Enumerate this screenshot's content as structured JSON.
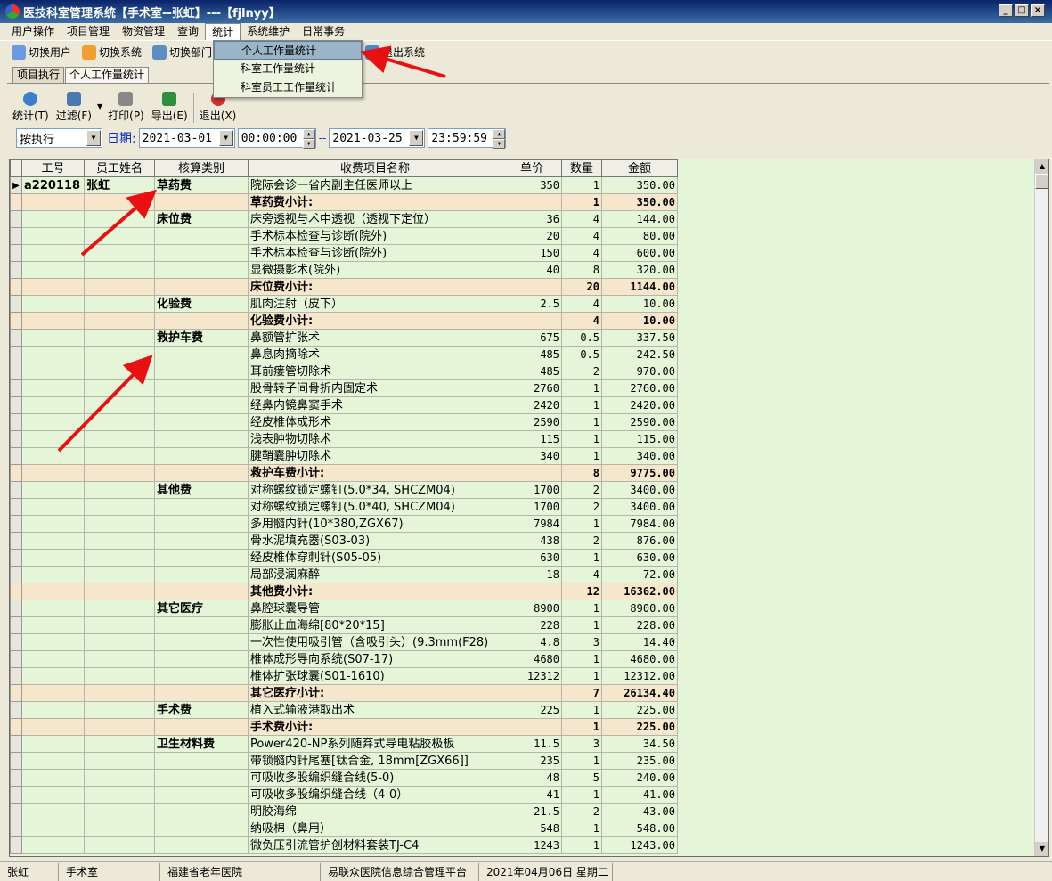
{
  "window": {
    "title": "医技科室管理系统【手术室--张虹】---【fjlnyy】"
  },
  "menubar": [
    "用户操作",
    "项目管理",
    "物资管理",
    "查询",
    "统计",
    "系统维护",
    "日常事务"
  ],
  "toolbar": [
    {
      "label": "切换用户",
      "icon": "switch-user-icon"
    },
    {
      "label": "切换系统",
      "icon": "switch-system-icon"
    },
    {
      "label": "切换部门",
      "icon": "switch-dept-icon"
    },
    {
      "label": "退出系统",
      "icon": "exit-system-icon"
    }
  ],
  "stats_menu": [
    "个人工作量统计",
    "科室工作量统计",
    "科室员工工作量统计"
  ],
  "tabs": [
    "项目执行",
    "个人工作量统计"
  ],
  "actions": [
    {
      "label": "统计(T)",
      "icon": "stats-icon"
    },
    {
      "label": "过滤(F)",
      "icon": "filter-icon"
    },
    {
      "label": "打印(P)",
      "icon": "print-icon"
    },
    {
      "label": "导出(E)",
      "icon": "export-icon"
    },
    {
      "label": "退出(X)",
      "icon": "exit-icon"
    }
  ],
  "filter": {
    "mode": "按执行",
    "date_label": "日期:",
    "start_date": "2021-03-01",
    "start_time": "00:00:00",
    "separator": "--",
    "end_date": "2021-03-25",
    "end_time": "23:59:59"
  },
  "columns": [
    "工号",
    "员工姓名",
    "核算类别",
    "收费项目名称",
    "单价",
    "数量",
    "金额"
  ],
  "rows": [
    [
      "a220118",
      "张虹",
      "草药费",
      "院际会诊一省内副主任医师以上",
      "350",
      "1",
      "350.00",
      0
    ],
    [
      "",
      "",
      "",
      "草药费小计:",
      "",
      "1",
      "350.00",
      1
    ],
    [
      "",
      "",
      "床位费",
      "床旁透视与术中透视（透视下定位）",
      "36",
      "4",
      "144.00",
      0
    ],
    [
      "",
      "",
      "",
      "手术标本检查与诊断(院外)",
      "20",
      "4",
      "80.00",
      0
    ],
    [
      "",
      "",
      "",
      "手术标本检查与诊断(院外)",
      "150",
      "4",
      "600.00",
      0
    ],
    [
      "",
      "",
      "",
      "显微摄影术(院外)",
      "40",
      "8",
      "320.00",
      0
    ],
    [
      "",
      "",
      "",
      "床位费小计:",
      "",
      "20",
      "1144.00",
      1
    ],
    [
      "",
      "",
      "化验费",
      "肌肉注射（皮下）",
      "2.5",
      "4",
      "10.00",
      0
    ],
    [
      "",
      "",
      "",
      "化验费小计:",
      "",
      "4",
      "10.00",
      1
    ],
    [
      "",
      "",
      "救护车费",
      "鼻额管扩张术",
      "675",
      "0.5",
      "337.50",
      0
    ],
    [
      "",
      "",
      "",
      "鼻息肉摘除术",
      "485",
      "0.5",
      "242.50",
      0
    ],
    [
      "",
      "",
      "",
      "耳前瘘管切除术",
      "485",
      "2",
      "970.00",
      0
    ],
    [
      "",
      "",
      "",
      "股骨转子间骨折内固定术",
      "2760",
      "1",
      "2760.00",
      0
    ],
    [
      "",
      "",
      "",
      "经鼻内镜鼻窦手术",
      "2420",
      "1",
      "2420.00",
      0
    ],
    [
      "",
      "",
      "",
      "经皮椎体成形术",
      "2590",
      "1",
      "2590.00",
      0
    ],
    [
      "",
      "",
      "",
      "浅表肿物切除术",
      "115",
      "1",
      "115.00",
      0
    ],
    [
      "",
      "",
      "",
      "腱鞘囊肿切除术",
      "340",
      "1",
      "340.00",
      0
    ],
    [
      "",
      "",
      "",
      "救护车费小计:",
      "",
      "8",
      "9775.00",
      1
    ],
    [
      "",
      "",
      "其他费",
      "对称螺纹锁定螺钉(5.0*34, SHCZM04)",
      "1700",
      "2",
      "3400.00",
      0
    ],
    [
      "",
      "",
      "",
      "对称螺纹锁定螺钉(5.0*40, SHCZM04)",
      "1700",
      "2",
      "3400.00",
      0
    ],
    [
      "",
      "",
      "",
      "多用髓内针(10*380,ZGX67)",
      "7984",
      "1",
      "7984.00",
      0
    ],
    [
      "",
      "",
      "",
      "骨水泥填充器(S03-03)",
      "438",
      "2",
      "876.00",
      0
    ],
    [
      "",
      "",
      "",
      "经皮椎体穿刺针(S05-05)",
      "630",
      "1",
      "630.00",
      0
    ],
    [
      "",
      "",
      "",
      "局部浸润麻醉",
      "18",
      "4",
      "72.00",
      0
    ],
    [
      "",
      "",
      "",
      "其他费小计:",
      "",
      "12",
      "16362.00",
      1
    ],
    [
      "",
      "",
      "其它医疗",
      "鼻腔球囊导管",
      "8900",
      "1",
      "8900.00",
      0
    ],
    [
      "",
      "",
      "",
      "膨胀止血海绵[80*20*15]",
      "228",
      "1",
      "228.00",
      0
    ],
    [
      "",
      "",
      "",
      "一次性使用吸引管（含吸引头）(9.3mm(F28)",
      "4.8",
      "3",
      "14.40",
      0
    ],
    [
      "",
      "",
      "",
      "椎体成形导向系统(S07-17)",
      "4680",
      "1",
      "4680.00",
      0
    ],
    [
      "",
      "",
      "",
      "椎体扩张球囊(S01-1610)",
      "12312",
      "1",
      "12312.00",
      0
    ],
    [
      "",
      "",
      "",
      "其它医疗小计:",
      "",
      "7",
      "26134.40",
      1
    ],
    [
      "",
      "",
      "手术费",
      "植入式输液港取出术",
      "225",
      "1",
      "225.00",
      0
    ],
    [
      "",
      "",
      "",
      "手术费小计:",
      "",
      "1",
      "225.00",
      1
    ],
    [
      "",
      "",
      "卫生材料费",
      "Power420-NP系列随弃式导电粘胶极板",
      "11.5",
      "3",
      "34.50",
      0
    ],
    [
      "",
      "",
      "",
      "带锁髓内针尾塞[钛合金, 18mm[ZGX66]]",
      "235",
      "1",
      "235.00",
      0
    ],
    [
      "",
      "",
      "",
      "可吸收多股编织缝合线(5-0)",
      "48",
      "5",
      "240.00",
      0
    ],
    [
      "",
      "",
      "",
      "可吸收多股编织缝合线（4-0）",
      "41",
      "1",
      "41.00",
      0
    ],
    [
      "",
      "",
      "",
      "明胶海绵",
      "21.5",
      "2",
      "43.00",
      0
    ],
    [
      "",
      "",
      "",
      "纳吸棉（鼻用）",
      "548",
      "1",
      "548.00",
      0
    ],
    [
      "",
      "",
      "",
      "微负压引流管护创材料套装TJ-C4",
      "1243",
      "1",
      "1243.00",
      0
    ]
  ],
  "status": [
    "张虹",
    "手术室",
    "福建省老年医院",
    "易联众医院信息综合管理平台",
    "2021年04月06日 星期二"
  ],
  "colors": {
    "title_bar": "#0a246a",
    "grid_bg": "#e4f5d8",
    "subtotal_bg": "#f6e6cc",
    "arrow": "#e81010"
  }
}
